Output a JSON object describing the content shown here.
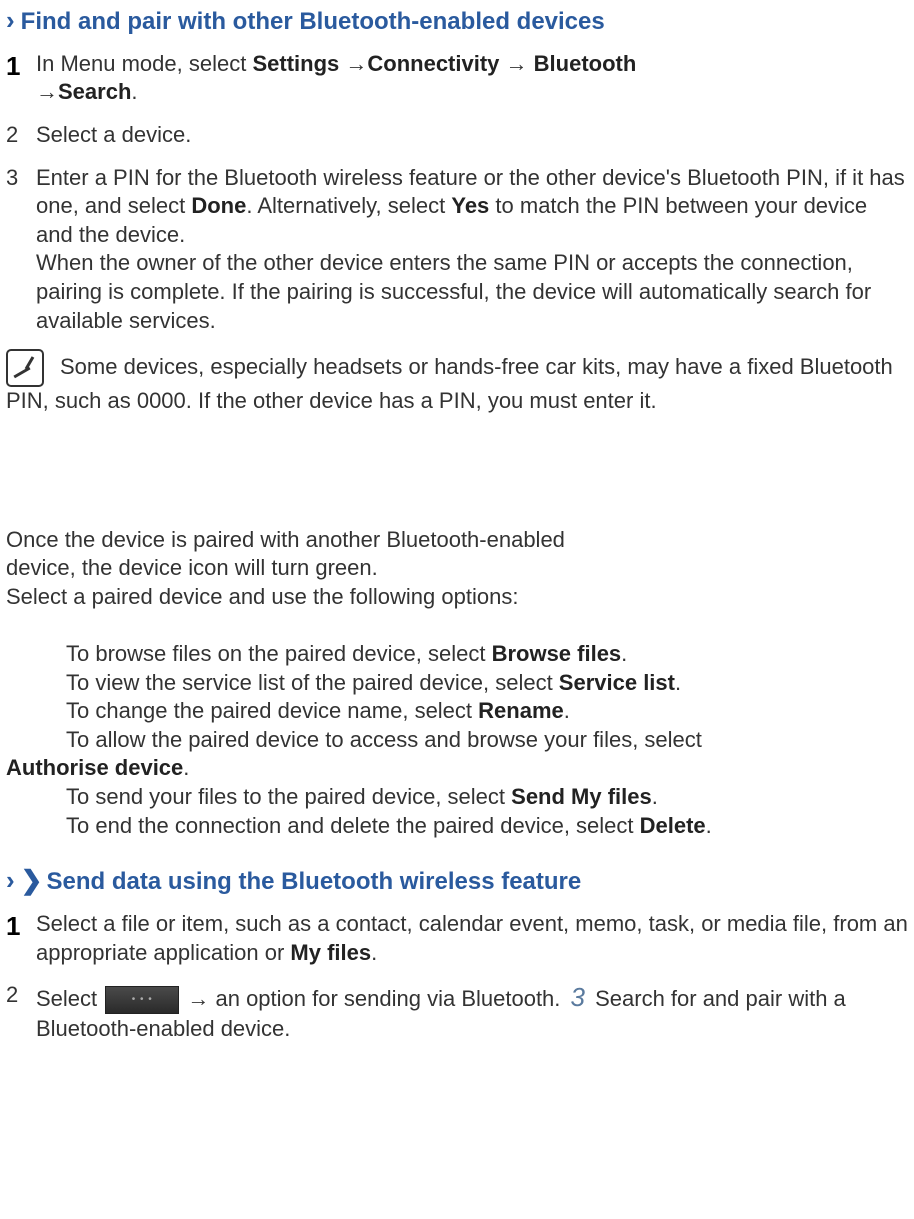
{
  "section1": {
    "heading": "Find and pair with other Bluetooth-enabled devices",
    "steps": {
      "s1": {
        "num": "1",
        "pre": "In Menu mode, select ",
        "b1": "Settings",
        "arr1": " →",
        "b2": "Connectivity",
        "arr2": " → ",
        "b3": "Bluetooth",
        "arr3": " →",
        "b4": "Search",
        "post": "."
      },
      "s2": {
        "num": "2",
        "text": "Select a device."
      },
      "s3": {
        "num": "3",
        "t1": "Enter a PIN for the Bluetooth wireless feature or the other device's Bluetooth PIN, if it has one, and select ",
        "b1": "Done",
        "t2": ". Alternatively, select ",
        "b2": "Yes",
        "t3": " to match the PIN between your device and the device.",
        "t4": "When the owner of the other device enters the same PIN or accepts the connection, pairing is complete. If the pairing is successful, the device will automatically search for available services."
      }
    },
    "note": "Some devices, especially headsets or hands-free car kits, may have a fixed Bluetooth PIN, such as 0000. If the other device has a PIN, you must enter it."
  },
  "middle": {
    "line1": "Once the device is paired with another Bluetooth-enabled\ndevice, the device icon will turn green.",
    "line2a": "Once the device is paired with another Bluetooth-enabled",
    "line2b": "device, the device icon will turn green.",
    "line3": "Select a paired device and use the following options:",
    "opts": {
      "o1a": "To browse files on the paired device, select ",
      "o1b": "Browse files",
      "o2a": "To view the service list of the paired device, select ",
      "o2b": "Service list",
      "o3a": "To change the paired device name, select ",
      "o3b": "Rename",
      "o4a": "To allow the paired device to access and browse your files, select ",
      "o4b": "Authorise device",
      "o5a": "To send your files to the paired device, select ",
      "o5b": "Send My files",
      "o6a": "To end the connection and delete the paired device, select ",
      "o6b": "Delete"
    }
  },
  "section2": {
    "heading": "Send data using the Bluetooth wireless feature",
    "steps": {
      "s1": {
        "num": "1",
        "t1": "Select a file or item, such as a contact, calendar event, memo, task, or media file, from an appropriate application or ",
        "b1": "My files",
        "t2": "."
      },
      "s2": {
        "num": "2",
        "t1": "Select  ",
        "t2": " → an option for sending via Bluetooth. ",
        "num3": "3",
        "t3": " Search for and pair with a Bluetooth-enabled device."
      }
    }
  }
}
